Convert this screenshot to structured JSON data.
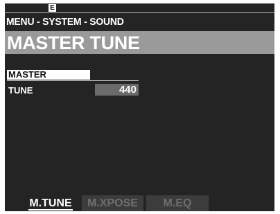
{
  "indicator": {
    "edit": "E"
  },
  "breadcrumb": "MENU - SYSTEM - SOUND",
  "page_title": "MASTER TUNE",
  "params": [
    {
      "label": "MASTER",
      "selected": true
    },
    {
      "label": "TUNE",
      "value": "440"
    }
  ],
  "tabs": [
    {
      "label": "M.TUNE",
      "active": true
    },
    {
      "label": "M.XPOSE",
      "active": false
    },
    {
      "label": "M.EQ",
      "active": false
    }
  ],
  "colors": {
    "screen_background": "#242424",
    "title_bar": "#9a9a9a",
    "value_box": "#6b6b6b",
    "text": "#ffffff"
  }
}
